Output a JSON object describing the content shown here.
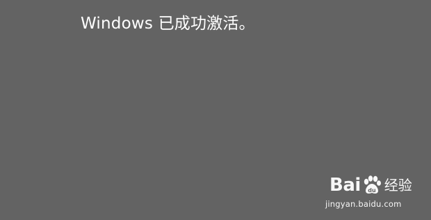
{
  "message": {
    "text": "Windows 已成功激活。"
  },
  "watermark": {
    "brand_part1": "Bai",
    "brand_part2": "经验",
    "paw_icon": "paw-icon",
    "url": "jingyan.baidu.com"
  },
  "colors": {
    "background": "#636363",
    "text": "#ffffff"
  }
}
